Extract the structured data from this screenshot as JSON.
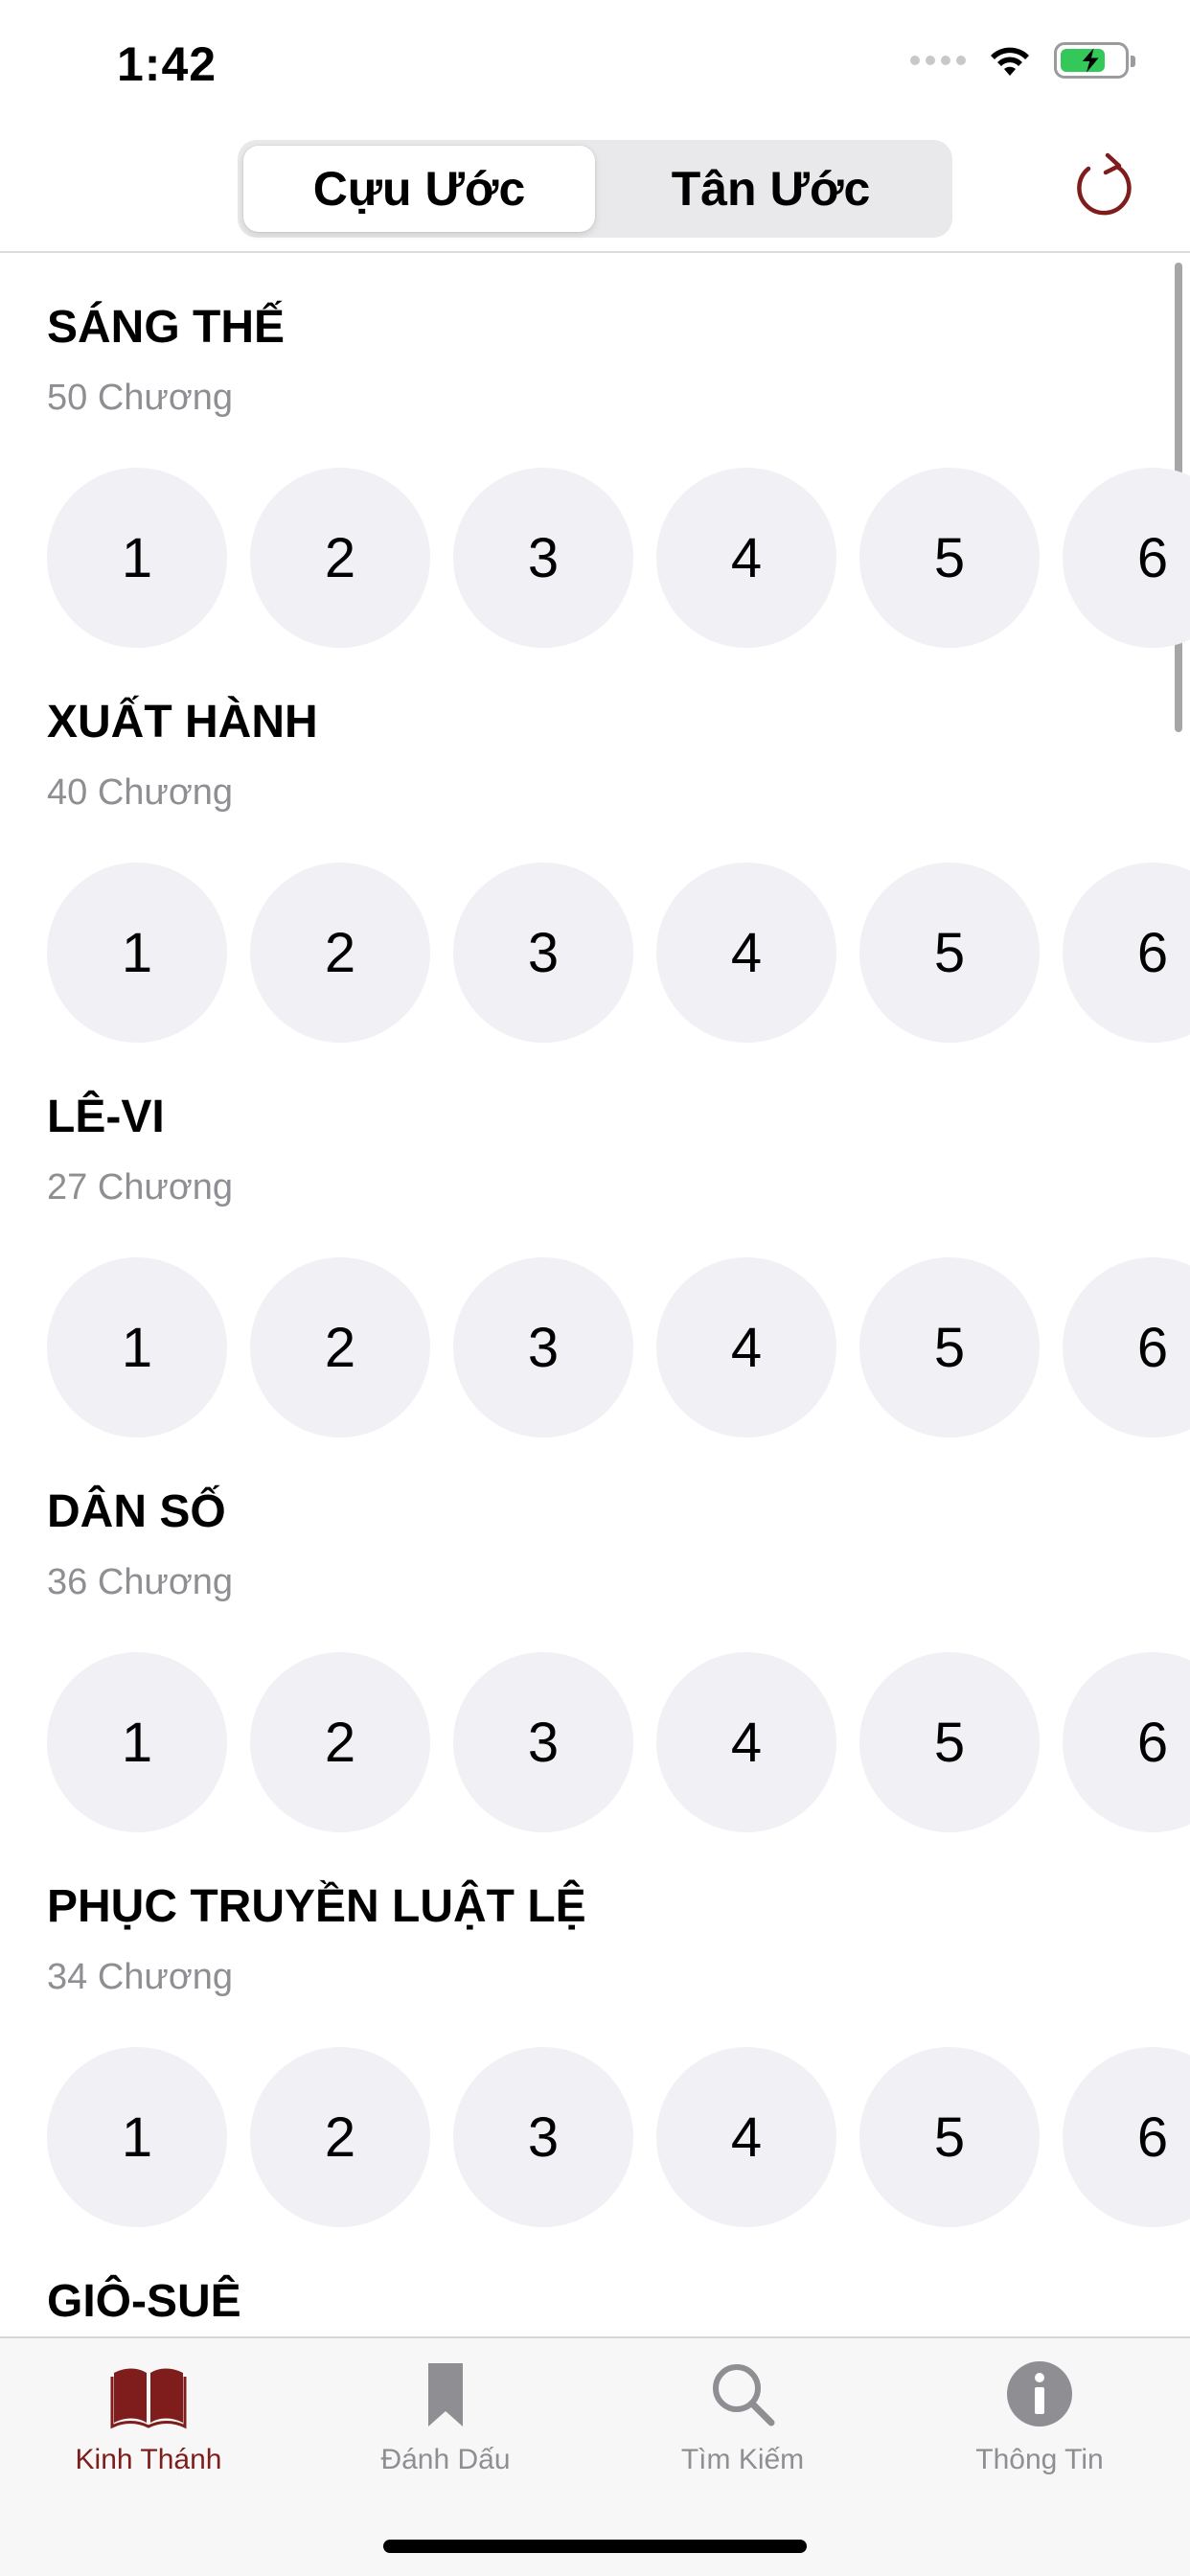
{
  "status": {
    "time": "1:42"
  },
  "header": {
    "segments": [
      "Cựu Ước",
      "Tân Ước"
    ],
    "selected_segment": "Cựu Ước",
    "refresh_icon": "refresh-icon"
  },
  "books": [
    {
      "title": "SÁNG THẾ",
      "count": "50 Chương",
      "chapters": [
        "1",
        "2",
        "3",
        "4",
        "5",
        "6"
      ]
    },
    {
      "title": "XUẤT HÀNH",
      "count": "40 Chương",
      "chapters": [
        "1",
        "2",
        "3",
        "4",
        "5",
        "6"
      ]
    },
    {
      "title": "LÊ-VI",
      "count": "27 Chương",
      "chapters": [
        "1",
        "2",
        "3",
        "4",
        "5",
        "6"
      ]
    },
    {
      "title": "DÂN SỐ",
      "count": "36 Chương",
      "chapters": [
        "1",
        "2",
        "3",
        "4",
        "5",
        "6"
      ]
    },
    {
      "title": "PHỤC TRUYỀN LUẬT LỆ",
      "count": "34 Chương",
      "chapters": [
        "1",
        "2",
        "3",
        "4",
        "5",
        "6"
      ]
    },
    {
      "title": "GIÔ-SUÊ"
    }
  ],
  "tabbar": {
    "items": [
      {
        "label": "Kinh Thánh",
        "icon": "book-icon",
        "active": true
      },
      {
        "label": "Đánh Dấu",
        "icon": "bookmark-icon",
        "active": false
      },
      {
        "label": "Tìm Kiếm",
        "icon": "search-icon",
        "active": false
      },
      {
        "label": "Thông Tin",
        "icon": "info-icon",
        "active": false
      }
    ]
  },
  "colors": {
    "accent": "#7f1d1d",
    "inactive": "#8e8e93",
    "chapter_bg": "#f1f1f5",
    "battery": "#34c759"
  },
  "battery_level": 0.72
}
